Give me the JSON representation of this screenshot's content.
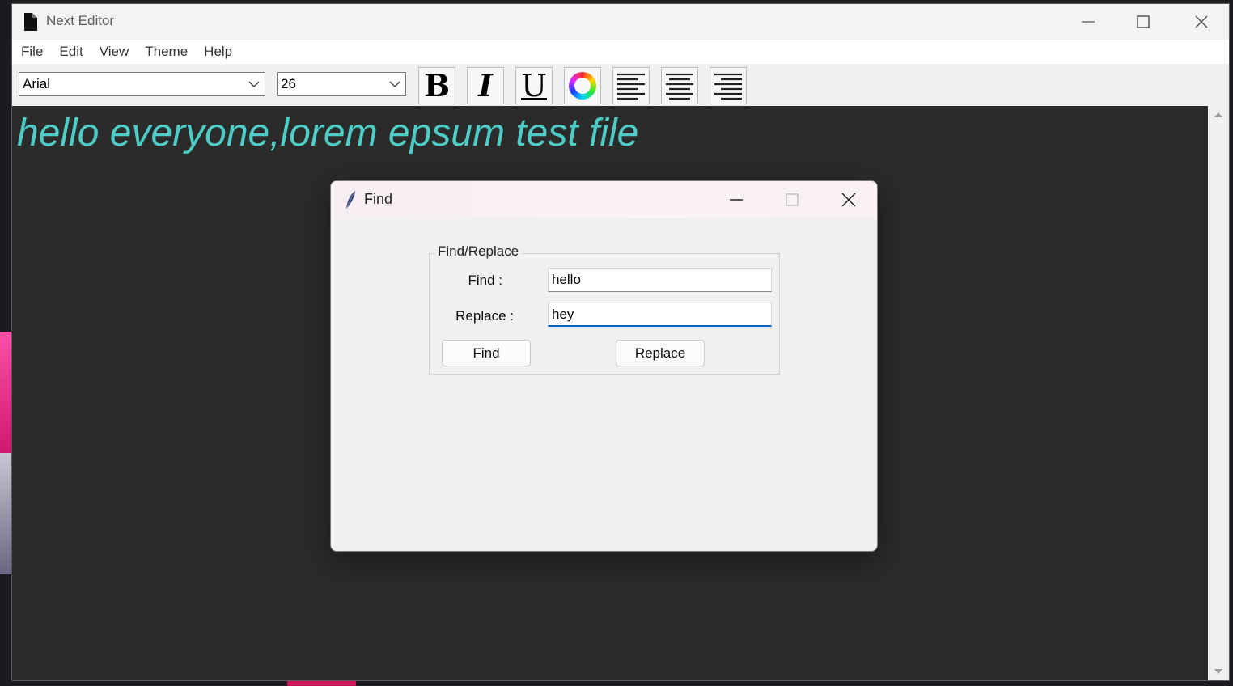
{
  "window": {
    "title": "Next Editor"
  },
  "menu": [
    "File",
    "Edit",
    "View",
    "Theme",
    "Help"
  ],
  "toolbar": {
    "font_family": "Arial",
    "font_size": "26",
    "bold_glyph": "B",
    "italic_glyph": "I",
    "underline_glyph": "U"
  },
  "editor": {
    "content": "hello everyone,lorem epsum test file",
    "text_color": "#4dcdc6",
    "background": "#2b2b2b"
  },
  "find_dialog": {
    "title": "Find",
    "group_title": "Find/Replace",
    "find_label": "Find :",
    "replace_label": "Replace :",
    "find_value": "hello",
    "replace_value": "hey",
    "find_button": "Find",
    "replace_button": "Replace"
  }
}
